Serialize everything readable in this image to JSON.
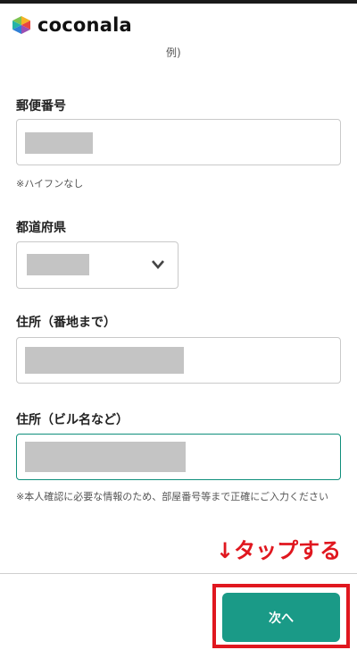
{
  "header": {
    "logo_text": "coconala"
  },
  "form": {
    "cut_text": "例)",
    "postal_code": {
      "label": "郵便番号",
      "help": "※ハイフンなし"
    },
    "prefecture": {
      "label": "都道府県"
    },
    "address1": {
      "label": "住所（番地まで）"
    },
    "address2": {
      "label": "住所（ビル名など）",
      "help": "※本人確認に必要な情報のため、部屋番号等まで正確にご入力ください"
    }
  },
  "annotation": {
    "text": "↓タップする"
  },
  "footer": {
    "next_label": "次へ"
  },
  "colors": {
    "accent": "#1a9a87",
    "annotation_red": "#e0171f"
  }
}
